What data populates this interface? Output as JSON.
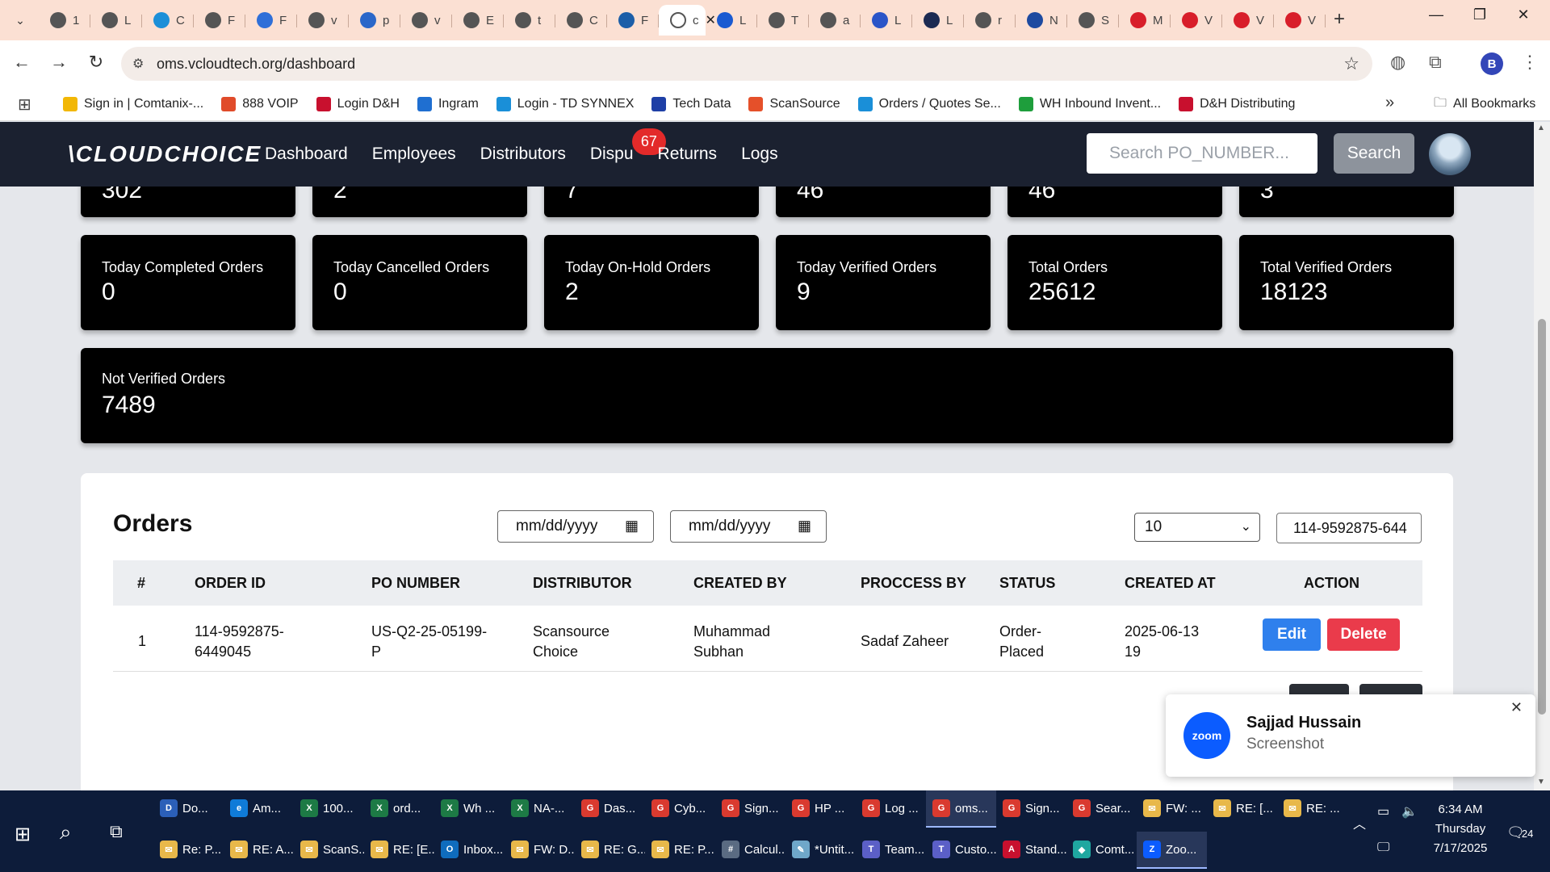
{
  "browser": {
    "tabs": [
      {
        "label": "1",
        "color": "#555555"
      },
      {
        "label": "L",
        "color": "#555555"
      },
      {
        "label": "C",
        "color": "#1c8fd8"
      },
      {
        "label": "F",
        "color": "#555555"
      },
      {
        "label": "F",
        "color": "#2f6fd8"
      },
      {
        "label": "v",
        "color": "#555555"
      },
      {
        "label": "p",
        "color": "#2b67c9"
      },
      {
        "label": "v",
        "color": "#555555"
      },
      {
        "label": "E",
        "color": "#555555"
      },
      {
        "label": "t",
        "color": "#555555"
      },
      {
        "label": "C",
        "color": "#555555"
      },
      {
        "label": "F",
        "color": "#1c5ea8"
      },
      {
        "label": "c",
        "color": "#ffffff",
        "active": true
      },
      {
        "label": "L",
        "color": "#1a5ad1"
      },
      {
        "label": "T",
        "color": "#555555"
      },
      {
        "label": "a",
        "color": "#555555"
      },
      {
        "label": "L",
        "color": "#2a55c8"
      },
      {
        "label": "L",
        "color": "#1b2a52"
      },
      {
        "label": "r",
        "color": "#555555"
      },
      {
        "label": "N",
        "color": "#1d4aa0"
      },
      {
        "label": "S",
        "color": "#555555"
      },
      {
        "label": "M",
        "color": "#d81e2a"
      },
      {
        "label": "V",
        "color": "#d81e2a"
      },
      {
        "label": "V",
        "color": "#d81e2a"
      },
      {
        "label": "V",
        "color": "#d81e2a"
      }
    ],
    "url": "oms.vcloudtech.org/dashboard",
    "profile_initial": "B",
    "bookmarks": [
      {
        "label": "Sign in | Comtanix-...",
        "color": "#f2b705"
      },
      {
        "label": "888 VOIP",
        "color": "#e04b2a"
      },
      {
        "label": "Login D&H",
        "color": "#c8102e"
      },
      {
        "label": "Ingram",
        "color": "#1f6fd1"
      },
      {
        "label": "Login - TD SYNNEX",
        "color": "#1a8fd8"
      },
      {
        "label": "Tech Data",
        "color": "#1e3fa6"
      },
      {
        "label": "ScanSource",
        "color": "#e5502a"
      },
      {
        "label": "Orders / Quotes Se...",
        "color": "#1a8fd8"
      },
      {
        "label": "WH Inbound Invent...",
        "color": "#1e9e3c"
      },
      {
        "label": "D&H Distributing",
        "color": "#c8102e"
      }
    ],
    "all_bookmarks": "All Bookmarks"
  },
  "app": {
    "logo": "\\CLOUDCHOICE",
    "nav": [
      "Dashboard",
      "Employees",
      "Distributors",
      "Dispu",
      "Returns",
      "Logs"
    ],
    "dispute_badge": "67",
    "search_placeholder": "Search PO_NUMBER...",
    "search_button": "Search"
  },
  "top_cards_partial": [
    "302",
    "2",
    "7",
    "46",
    "46",
    "3"
  ],
  "cards": [
    {
      "label": "Today Completed Orders",
      "value": "0"
    },
    {
      "label": "Today Cancelled Orders",
      "value": "0"
    },
    {
      "label": "Today On-Hold Orders",
      "value": "2"
    },
    {
      "label": "Today Verified Orders",
      "value": "9"
    },
    {
      "label": "Total Orders",
      "value": "25612"
    },
    {
      "label": "Total Verified Orders",
      "value": "18123"
    }
  ],
  "not_verified": {
    "label": "Not Verified Orders",
    "value": "7489"
  },
  "orders": {
    "title": "Orders",
    "date_from": "mm/dd/yyyy",
    "date_to": "mm/dd/yyyy",
    "per_page": "10",
    "filter_value": "114-9592875-644",
    "columns": [
      "#",
      "ORDER ID",
      "PO NUMBER",
      "DISTRIBUTOR",
      "CREATED BY",
      "PROCCESS BY",
      "STATUS",
      "CREATED AT",
      "ACTION"
    ],
    "rows": [
      {
        "num": "1",
        "order_id": [
          "114-9592875-",
          "6449045"
        ],
        "po_number": [
          "US-Q2-25-05199-",
          "P"
        ],
        "distributor": [
          "Scansource",
          "Choice"
        ],
        "created_by": [
          "Muhammad",
          "Subhan"
        ],
        "process_by": "Sadaf Zaheer",
        "status": [
          "Order-",
          "Placed"
        ],
        "created_at": [
          "2025-06-13",
          "19"
        ]
      }
    ],
    "edit_label": "Edit",
    "delete_label": "Delete"
  },
  "zoom_toast": {
    "logo": "zoom",
    "name": "Sajjad Hussain",
    "subtitle": "Screenshot"
  },
  "taskbar": {
    "row1": [
      {
        "label": "Do...",
        "color": "#2b5fb8",
        "icon": "D"
      },
      {
        "label": "Am...",
        "color": "#0f7bd8",
        "icon": "e"
      },
      {
        "label": "100...",
        "color": "#1d7a45",
        "icon": "X"
      },
      {
        "label": "ord...",
        "color": "#1d7a45",
        "icon": "X"
      },
      {
        "label": "Wh ...",
        "color": "#1d7a45",
        "icon": "X"
      },
      {
        "label": "NA-...",
        "color": "#1d7a45",
        "icon": "X"
      },
      {
        "label": "Das...",
        "color": "#d93a2f",
        "icon": "G"
      },
      {
        "label": "Cyb...",
        "color": "#d93a2f",
        "icon": "G"
      },
      {
        "label": "Sign...",
        "color": "#d93a2f",
        "icon": "G"
      },
      {
        "label": "HP ...",
        "color": "#d93a2f",
        "icon": "G"
      },
      {
        "label": "Log ...",
        "color": "#d93a2f",
        "icon": "G"
      },
      {
        "label": "oms...",
        "color": "#d93a2f",
        "icon": "G",
        "active": true
      },
      {
        "label": "Sign...",
        "color": "#d93a2f",
        "icon": "G"
      },
      {
        "label": "Sear...",
        "color": "#d93a2f",
        "icon": "G"
      },
      {
        "label": "FW: ...",
        "color": "#e8b84a",
        "icon": "✉"
      },
      {
        "label": "RE: [...",
        "color": "#e8b84a",
        "icon": "✉"
      },
      {
        "label": "RE: ...",
        "color": "#e8b84a",
        "icon": "✉"
      }
    ],
    "row2": [
      {
        "label": "Re: P...",
        "color": "#e8b84a",
        "icon": "✉"
      },
      {
        "label": "RE: A...",
        "color": "#e8b84a",
        "icon": "✉"
      },
      {
        "label": "ScanS...",
        "color": "#e8b84a",
        "icon": "✉"
      },
      {
        "label": "RE: [E...",
        "color": "#e8b84a",
        "icon": "✉"
      },
      {
        "label": "Inbox...",
        "color": "#0f6cbd",
        "icon": "O"
      },
      {
        "label": "FW: D...",
        "color": "#e8b84a",
        "icon": "✉"
      },
      {
        "label": "RE: G...",
        "color": "#e8b84a",
        "icon": "✉"
      },
      {
        "label": "RE: P...",
        "color": "#e8b84a",
        "icon": "✉"
      },
      {
        "label": "Calcul...",
        "color": "#5a6b82",
        "icon": "#"
      },
      {
        "label": "*Untit...",
        "color": "#6fa7c9",
        "icon": "✎"
      },
      {
        "label": "Team...",
        "color": "#5b5fc7",
        "icon": "T"
      },
      {
        "label": "Custo...",
        "color": "#5b5fc7",
        "icon": "T"
      },
      {
        "label": "Stand...",
        "color": "#c8102e",
        "icon": "A"
      },
      {
        "label": "Comt...",
        "color": "#1fa7a0",
        "icon": "◆"
      },
      {
        "label": "Zoo...",
        "color": "#0b5cff",
        "icon": "Z",
        "active": true
      }
    ],
    "time": "6:34 AM",
    "day": "Thursday",
    "date": "7/17/2025",
    "notif_count": "24"
  }
}
